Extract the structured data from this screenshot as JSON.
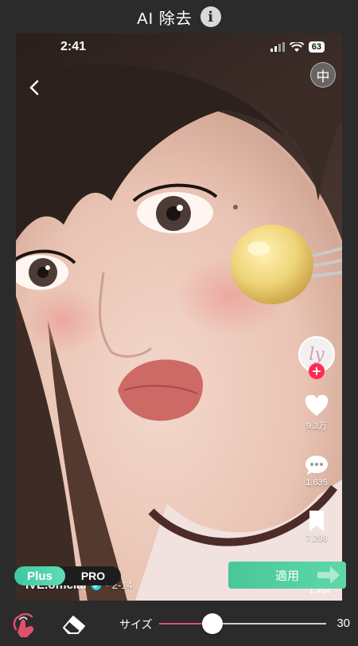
{
  "header": {
    "title": "AI 除去",
    "info_icon": "info-icon"
  },
  "phone": {
    "status_time": "2:41",
    "battery": "63",
    "translate_glyph": "中",
    "side_rail": {
      "avatar_text": "ly",
      "likes": "9.3万",
      "comments": "1,635",
      "saves": "7,208",
      "shares": "1,454"
    },
    "creator": {
      "name": "IVE.official",
      "date": "· 2-14"
    }
  },
  "plan_toggle": {
    "plus": "Plus",
    "pro": "PRO"
  },
  "apply_button": {
    "label": "適用"
  },
  "toolbar": {
    "size_label": "サイズ",
    "size_value": "30",
    "size_fraction": 0.32
  },
  "colors": {
    "accent": "#e0506e",
    "apply": "#4fcb9e",
    "background": "#2b2b2b"
  }
}
